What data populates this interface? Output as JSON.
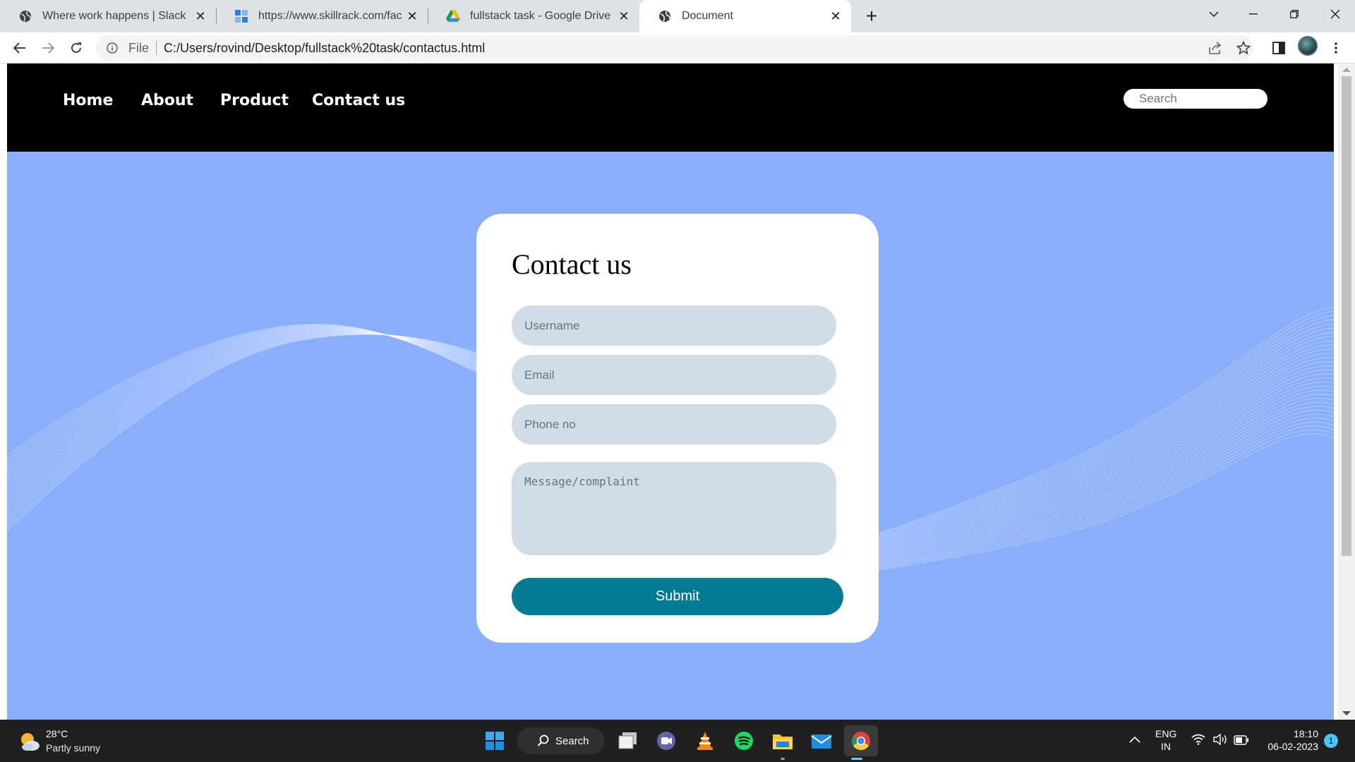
{
  "browser": {
    "tabs": [
      {
        "title": "Where work happens | Slack",
        "icon": "globe-icon"
      },
      {
        "title": "https://www.skillrack.com/faces/c",
        "icon": "skillrack-icon"
      },
      {
        "title": "fullstack task - Google Drive",
        "icon": "google-drive-icon"
      },
      {
        "title": "Document",
        "icon": "globe-icon",
        "active": true
      }
    ],
    "close_glyph": "✕",
    "new_tab_glyph": "+",
    "address": {
      "scheme": "File",
      "url": "C:/Users/rovind/Desktop/fullstack%20task/contactus.html"
    }
  },
  "site": {
    "nav": [
      "Home",
      "About",
      "Product",
      "Contact us"
    ],
    "search_placeholder": "Search",
    "background_color": "#8aaefc"
  },
  "form": {
    "title": "Contact us",
    "username_placeholder": "Username",
    "email_placeholder": "Email",
    "phone_placeholder": "Phone no",
    "message_placeholder": "Message/complaint",
    "submit_label": "Submit",
    "submit_color": "#047b92"
  },
  "taskbar": {
    "weather_temp": "28°C",
    "weather_desc": "Partly sunny",
    "search_label": "Search",
    "lang": "ENG",
    "region": "IN",
    "time": "18:10",
    "date": "06-02-2023",
    "notification_count": "1",
    "apps": [
      "windows-start-icon",
      "task-view-icon",
      "teams-chat-icon",
      "vlc-icon",
      "spotify-icon",
      "file-explorer-icon",
      "mail-icon",
      "chrome-icon"
    ]
  }
}
